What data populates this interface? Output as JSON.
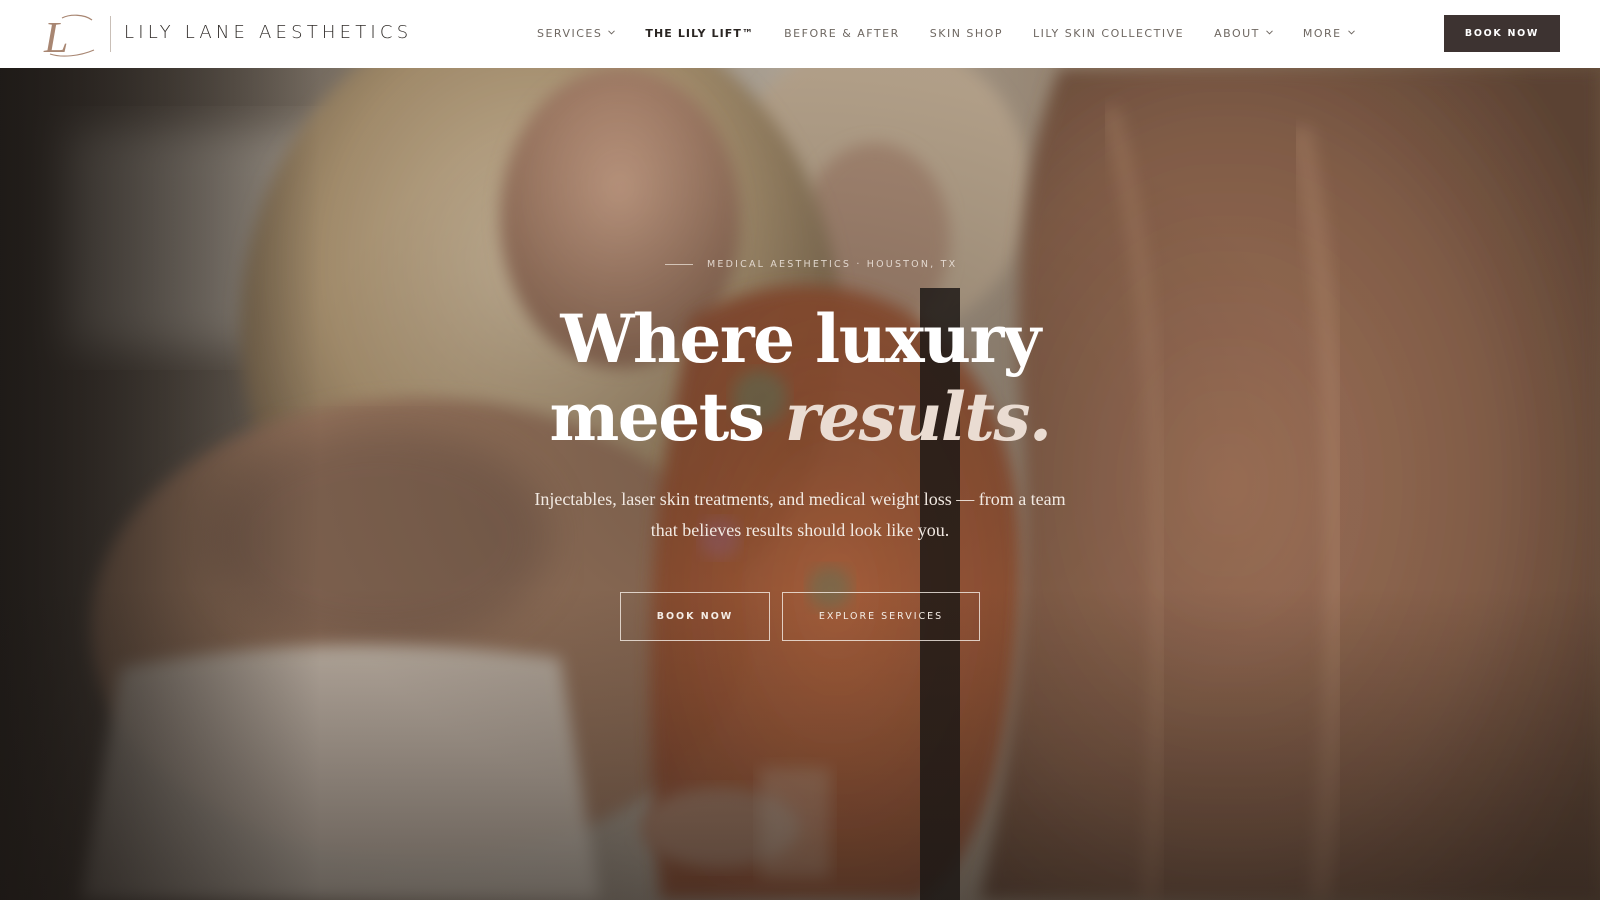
{
  "brand": {
    "name": "LILY LANE AESTHETICS",
    "logo_monogram": "L"
  },
  "nav": {
    "items": [
      {
        "label": "SERVICES",
        "has_dropdown": true
      },
      {
        "label": "THE LILY LIFT™",
        "has_dropdown": false,
        "active": true
      },
      {
        "label": "BEFORE & AFTER",
        "has_dropdown": false
      },
      {
        "label": "SKIN SHOP",
        "has_dropdown": false
      },
      {
        "label": "LILY SKIN COLLECTIVE",
        "has_dropdown": false
      },
      {
        "label": "ABOUT",
        "has_dropdown": true
      },
      {
        "label": "MORE",
        "has_dropdown": true
      }
    ],
    "book_label": "BOOK NOW"
  },
  "hero": {
    "eyebrow": "MEDICAL AESTHETICS · HOUSTON, TX",
    "headline_line1": "Where luxury",
    "headline_line2_plain": "meets ",
    "headline_line2_italic": "results.",
    "subtext": "Injectables, laser skin treatments, and medical weight loss — from a team that believes results should look like you.",
    "primary_cta": "BOOK NOW",
    "secondary_cta": "EXPLORE SERVICES"
  },
  "colors": {
    "header_bg": "#ffffff",
    "brand_text": "#2e2a27",
    "cta_dark": "#3d3331",
    "logo_accent": "#a88672",
    "hero_text": "#ffffff"
  },
  "icons": {
    "dropdown": "chevron-down-icon",
    "logo": "monogram-logo"
  }
}
